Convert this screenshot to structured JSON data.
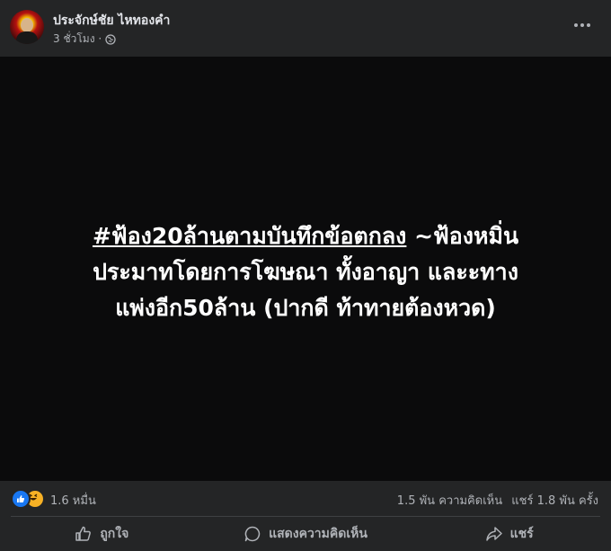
{
  "post": {
    "author": "ประจักษ์ชัย ไหทองคำ",
    "time": "3 ชั่วโมง ·",
    "privacy_icon": "globe-icon",
    "more_icon": "more-dots-icon"
  },
  "media": {
    "hashtag": "#ฟ้อง20ล้านตามบันทึกข้อตกลง",
    "line1_rest": " ~ฟ้องหมิ่น",
    "line2": "ประมาทโดยการโฆษณา ทั้งอาญา และะทาง",
    "line3": "แพ่งอีก50ล้าน (ปากดี ท้าทายต้องหวด)"
  },
  "reactions": {
    "icons": [
      "like-reaction-icon",
      "haha-reaction-icon"
    ],
    "count": "1.6 หมื่น",
    "comments": "1.5 พัน ความคิดเห็น",
    "shares": "แชร์ 1.8 พัน ครั้ง"
  },
  "actions": {
    "like": "ถูกใจ",
    "comment": "แสดงความคิดเห็น",
    "share": "แชร์"
  },
  "colors": {
    "background": "#242526",
    "media_background": "#0b0b0c",
    "primary_text": "#e4e6eb",
    "secondary_text": "#b0b3b8",
    "like_blue": "#1877f2",
    "haha_yellow": "#f7b125"
  }
}
